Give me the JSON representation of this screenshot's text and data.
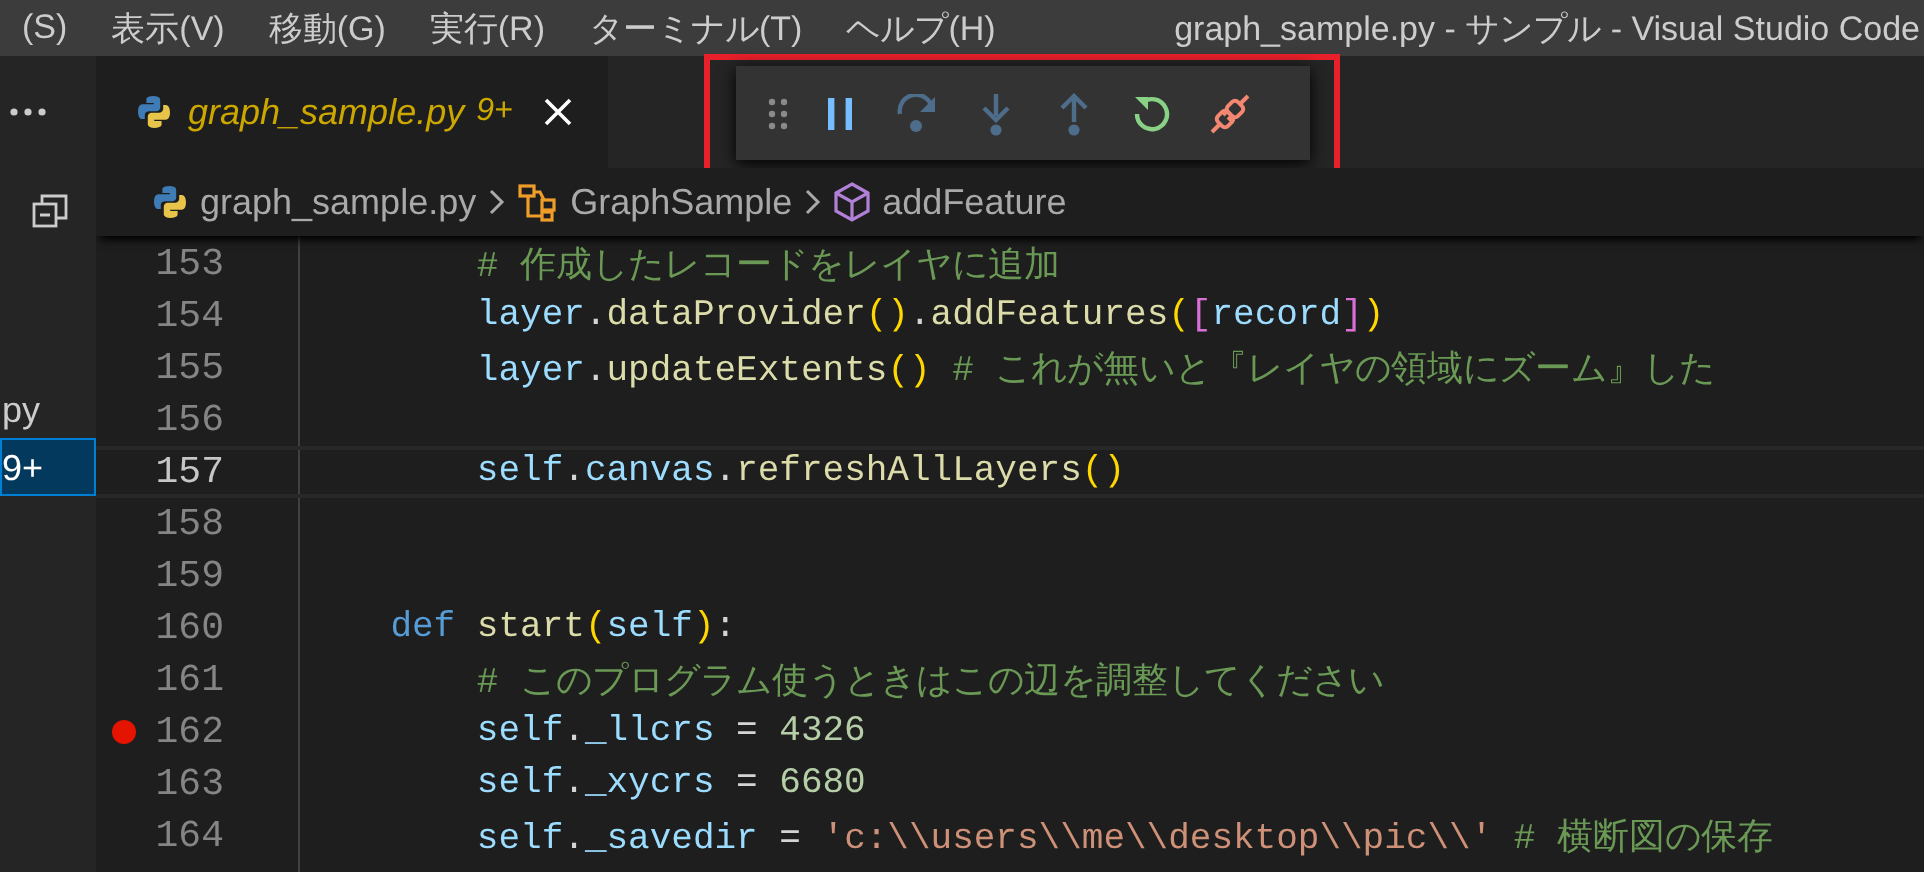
{
  "menu": [
    "(S)",
    "表示(V)",
    "移動(G)",
    "実行(R)",
    "ターミナル(T)",
    "ヘルプ(H)"
  ],
  "window_title": "graph_sample.py - サンプル - Visual Studio Code",
  "sidebar": {
    "items": [
      {
        "label": "py",
        "selected": false
      },
      {
        "label": "9+",
        "selected": true
      }
    ]
  },
  "tabs": [
    {
      "label": "graph_sample.py",
      "badge": "9+",
      "preview": true,
      "selected": true
    }
  ],
  "debug_toolbar": {
    "buttons": [
      {
        "kind": "gripper"
      },
      {
        "kind": "pause",
        "disabled": false
      },
      {
        "kind": "step-over",
        "disabled": true
      },
      {
        "kind": "step-into",
        "disabled": true
      },
      {
        "kind": "step-out",
        "disabled": true
      },
      {
        "kind": "restart",
        "disabled": false
      },
      {
        "kind": "disconnect",
        "disabled": false
      }
    ]
  },
  "breadcrumb": [
    {
      "kind": "file",
      "label": "graph_sample.py"
    },
    {
      "kind": "class",
      "label": "GraphSample"
    },
    {
      "kind": "method",
      "label": "addFeature"
    }
  ],
  "editor": {
    "lines": [
      {
        "number": "153",
        "current": false,
        "breakpoint": false,
        "segments": [
          {
            "kind": "comment",
            "text": "        # 作成したレコードをレイヤに追加"
          }
        ]
      },
      {
        "number": "154",
        "current": false,
        "breakpoint": false,
        "segments": [
          {
            "kind": "var",
            "text": "        layer"
          },
          {
            "kind": "plain",
            "text": "."
          },
          {
            "kind": "func",
            "text": "dataProvider"
          },
          {
            "kind": "paren",
            "text": "()"
          },
          {
            "kind": "plain",
            "text": "."
          },
          {
            "kind": "func",
            "text": "addFeatures"
          },
          {
            "kind": "paren",
            "text": "("
          },
          {
            "kind": "bracket",
            "text": "["
          },
          {
            "kind": "var",
            "text": "record"
          },
          {
            "kind": "bracket",
            "text": "]"
          },
          {
            "kind": "paren",
            "text": ")"
          }
        ]
      },
      {
        "number": "155",
        "current": false,
        "breakpoint": false,
        "segments": [
          {
            "kind": "var",
            "text": "        layer"
          },
          {
            "kind": "plain",
            "text": "."
          },
          {
            "kind": "func",
            "text": "updateExtents"
          },
          {
            "kind": "paren",
            "text": "()"
          },
          {
            "kind": "comment",
            "text": " # これが無いと『レイヤの領域にズーム』した"
          }
        ]
      },
      {
        "number": "156",
        "current": false,
        "breakpoint": false
      },
      {
        "number": "157",
        "current": true,
        "breakpoint": false,
        "segments": [
          {
            "kind": "var",
            "text": "        self"
          },
          {
            "kind": "plain",
            "text": "."
          },
          {
            "kind": "var",
            "text": "canvas"
          },
          {
            "kind": "plain",
            "text": "."
          },
          {
            "kind": "func",
            "text": "refreshAllLayers"
          },
          {
            "kind": "paren",
            "text": "()"
          }
        ]
      },
      {
        "number": "158",
        "current": false,
        "breakpoint": false
      },
      {
        "number": "159",
        "current": false,
        "breakpoint": false
      },
      {
        "number": "160",
        "current": false,
        "breakpoint": false,
        "segments": [
          {
            "kind": "keyword",
            "text": "    def "
          },
          {
            "kind": "func",
            "text": "start"
          },
          {
            "kind": "paren",
            "text": "("
          },
          {
            "kind": "var",
            "text": "self"
          },
          {
            "kind": "paren",
            "text": ")"
          },
          {
            "kind": "plain",
            "text": ":"
          }
        ]
      },
      {
        "number": "161",
        "current": false,
        "breakpoint": false,
        "segments": [
          {
            "kind": "comment",
            "text": "        # このプログラム使うときはこの辺を調整してください"
          }
        ]
      },
      {
        "number": "162",
        "current": false,
        "breakpoint": true,
        "segments": [
          {
            "kind": "var",
            "text": "        self"
          },
          {
            "kind": "plain",
            "text": "."
          },
          {
            "kind": "var",
            "text": "_llcrs"
          },
          {
            "kind": "plain",
            "text": " = "
          },
          {
            "kind": "number",
            "text": "4326"
          }
        ]
      },
      {
        "number": "163",
        "current": false,
        "breakpoint": false,
        "segments": [
          {
            "kind": "var",
            "text": "        self"
          },
          {
            "kind": "plain",
            "text": "."
          },
          {
            "kind": "var",
            "text": "_xycrs"
          },
          {
            "kind": "plain",
            "text": " = "
          },
          {
            "kind": "number",
            "text": "6680"
          }
        ]
      },
      {
        "number": "164",
        "current": false,
        "breakpoint": false,
        "segments": [
          {
            "kind": "var",
            "text": "        self"
          },
          {
            "kind": "plain",
            "text": "."
          },
          {
            "kind": "var",
            "text": "_savedir"
          },
          {
            "kind": "plain",
            "text": " = "
          },
          {
            "kind": "string",
            "text": "'c:\\\\users\\\\me\\\\desktop\\\\pic\\\\'"
          },
          {
            "kind": "comment",
            "text": " # 横断図の保存"
          }
        ]
      }
    ]
  }
}
